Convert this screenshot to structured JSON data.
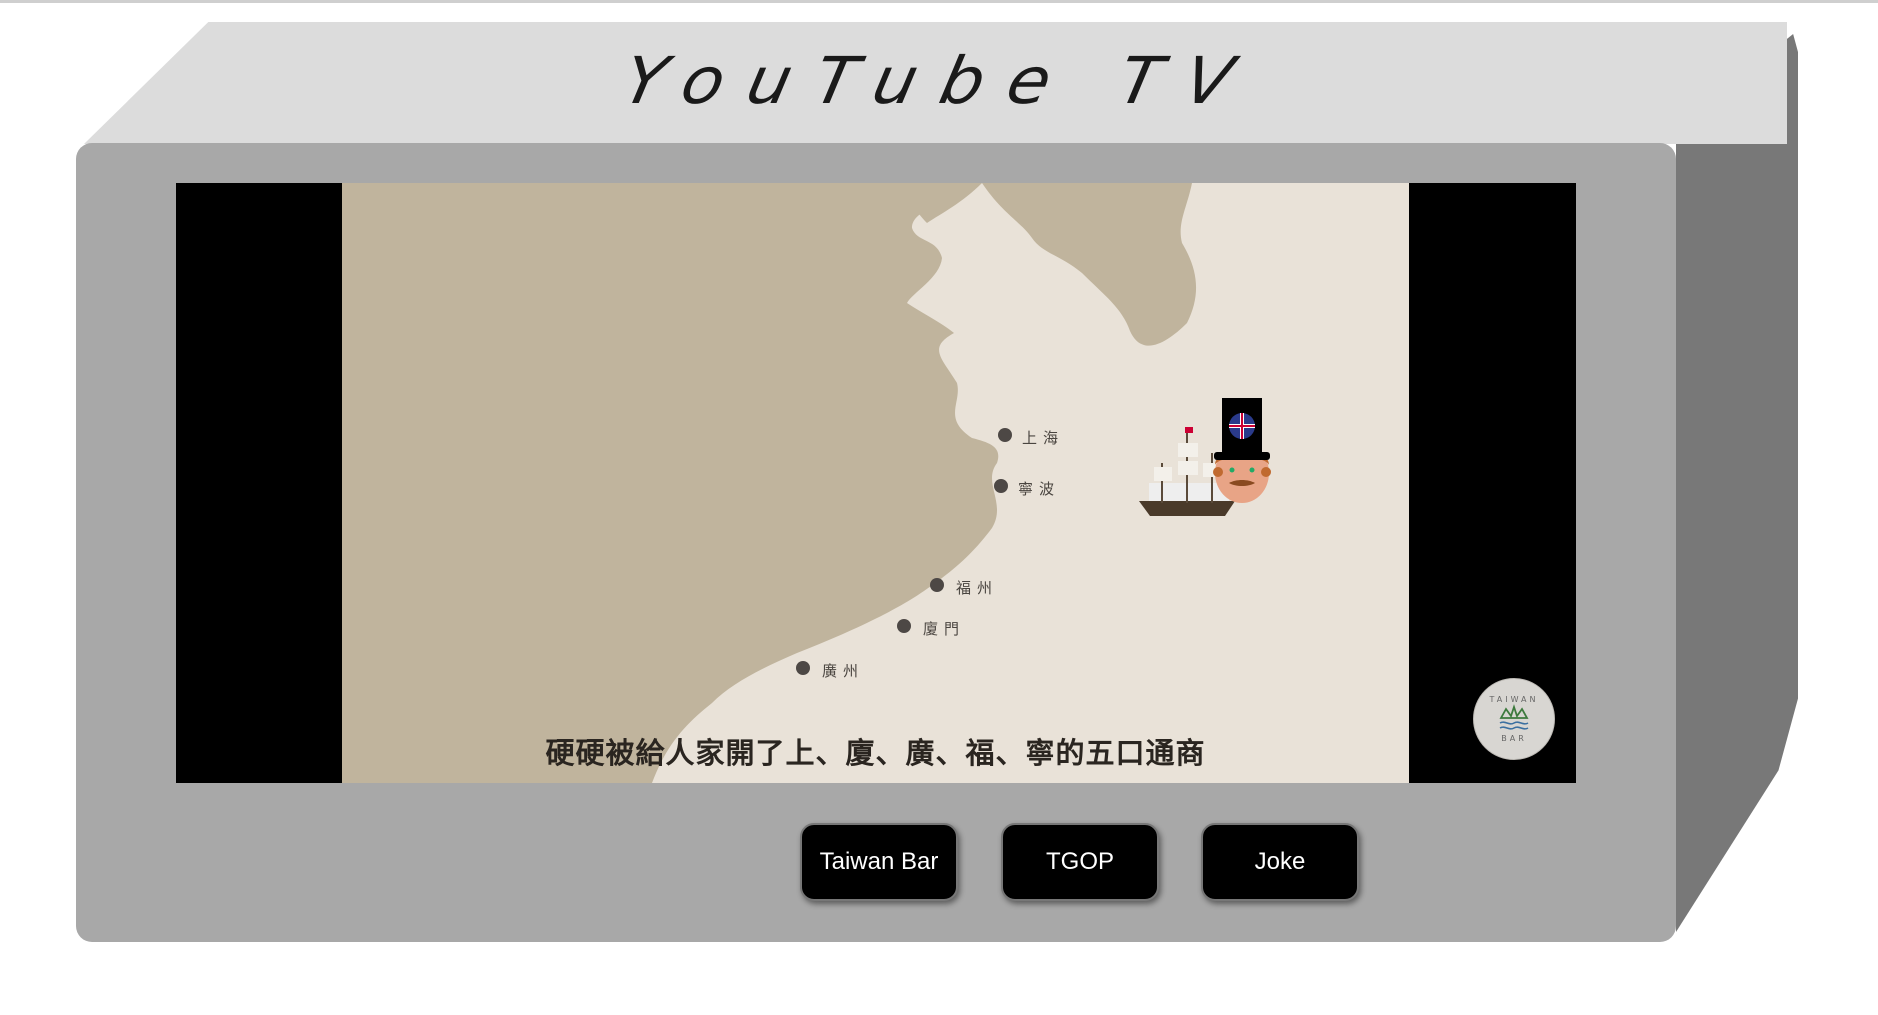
{
  "tv": {
    "title": "YouTube TV"
  },
  "video": {
    "subtitle": "硬硬被給人家開了上、廈、廣、福、寧的五口通商",
    "cities": [
      {
        "name": "上海"
      },
      {
        "name": "寧波"
      },
      {
        "name": "福州"
      },
      {
        "name": "廈門"
      },
      {
        "name": "廣州"
      }
    ],
    "watermark_top": "TAIWAN",
    "watermark_bottom": "BAR"
  },
  "channels": [
    {
      "label": "Taiwan Bar"
    },
    {
      "label": "TGOP"
    },
    {
      "label": "Joke"
    }
  ],
  "colors": {
    "tv_top": "#dcdcdc",
    "tv_front": "#a8a8a8",
    "tv_side": "#787878",
    "land": "#c0b49d",
    "sea": "#e9e2d8",
    "button_bg": "#000000"
  }
}
